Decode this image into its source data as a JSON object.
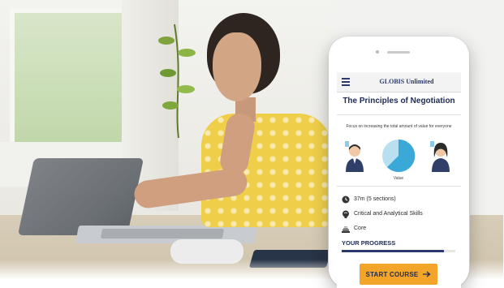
{
  "app": {
    "brand": "GLOBIS Unlimited"
  },
  "course": {
    "title": "The Principles of Negotiation",
    "subtitle": "Focus on increasing the total amount of value for everyone",
    "chart_label": "Value",
    "details": [
      {
        "icon": "clock-icon",
        "text": "37m (5 sections)"
      },
      {
        "icon": "brain-icon",
        "text": "Critical and Analytical Skills"
      },
      {
        "icon": "level-icon",
        "text": "Core"
      }
    ]
  },
  "progress": {
    "label": "YOUR PROGRESS",
    "value": 0.9
  },
  "actions": {
    "start_label": "START COURSE"
  },
  "colors": {
    "accent": "#f2a528",
    "navy": "#1c2b57",
    "pie_light": "#b9e0f1",
    "pie_dark": "#3aa9d8"
  },
  "icons": {
    "menu": "hamburger-icon",
    "arrow": "arrow-right-icon",
    "avatar_left": "man-avatar-icon",
    "avatar_right": "woman-avatar-icon"
  }
}
